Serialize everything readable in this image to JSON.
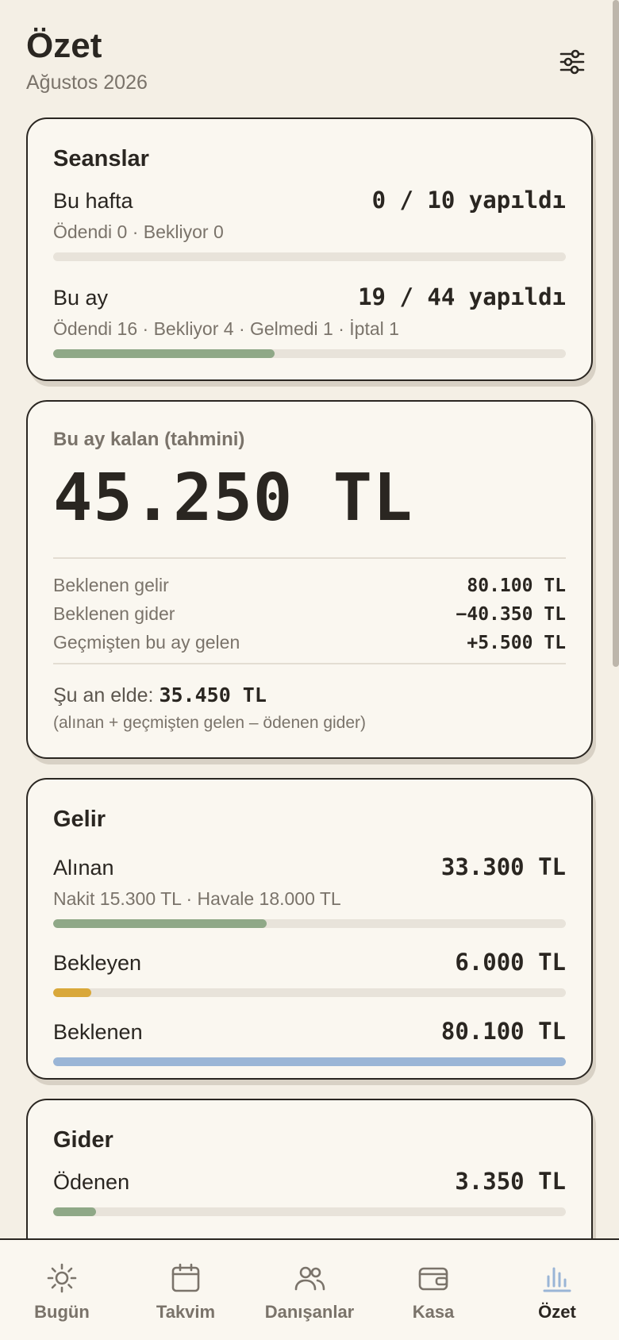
{
  "header": {
    "title": "Özet",
    "subtitle": "Ağustos 2026"
  },
  "sessions": {
    "title": "Seanslar",
    "week": {
      "label": "Bu hafta",
      "value": "0 / 10 yapıldı",
      "sub": "Ödendi 0 · Bekliyor 0",
      "progress": 0
    },
    "month": {
      "label": "Bu ay",
      "value": "19 / 44 yapıldı",
      "sub": "Ödendi 16 · Bekliyor 4 · Gelmedi 1 · İptal 1",
      "progress": 0.432
    }
  },
  "remaining": {
    "label": "Bu ay kalan (tahmini)",
    "amount": "45.250 TL",
    "items": [
      {
        "label": "Beklenen gelir",
        "value": "80.100 TL"
      },
      {
        "label": "Beklenen gider",
        "value": "−40.350 TL"
      },
      {
        "label": "Geçmişten bu ay gelen",
        "value": "+5.500 TL"
      }
    ],
    "cash_label": "Şu an elde:",
    "cash_value": "35.450 TL",
    "cash_note": "(alınan + geçmişten gelen – ödenen gider)"
  },
  "income": {
    "title": "Gelir",
    "received": {
      "label": "Alınan",
      "value": "33.300 TL",
      "sub": "Nakit 15.300 TL · Havale 18.000 TL",
      "progress": 0.416
    },
    "pending": {
      "label": "Bekleyen",
      "value": "6.000 TL",
      "progress": 0.075
    },
    "expected": {
      "label": "Beklenen",
      "value": "80.100 TL",
      "progress": 1.0
    }
  },
  "expense": {
    "title": "Gider",
    "paid": {
      "label": "Ödenen",
      "value": "3.350 TL",
      "progress": 0.083
    }
  },
  "nav": [
    {
      "label": "Bugün",
      "icon": "sun-icon",
      "active": false
    },
    {
      "label": "Takvim",
      "icon": "calendar-icon",
      "active": false
    },
    {
      "label": "Danışanlar",
      "icon": "users-icon",
      "active": false
    },
    {
      "label": "Kasa",
      "icon": "wallet-icon",
      "active": false
    },
    {
      "label": "Özet",
      "icon": "bar-chart-icon",
      "active": true
    }
  ],
  "colors": {
    "green": "#8fa887",
    "yellow": "#d9a83a",
    "blue": "#9ab5d6",
    "active_nav": "#9ab5d6",
    "ink": "#2a2621",
    "muted": "#7a736a"
  }
}
